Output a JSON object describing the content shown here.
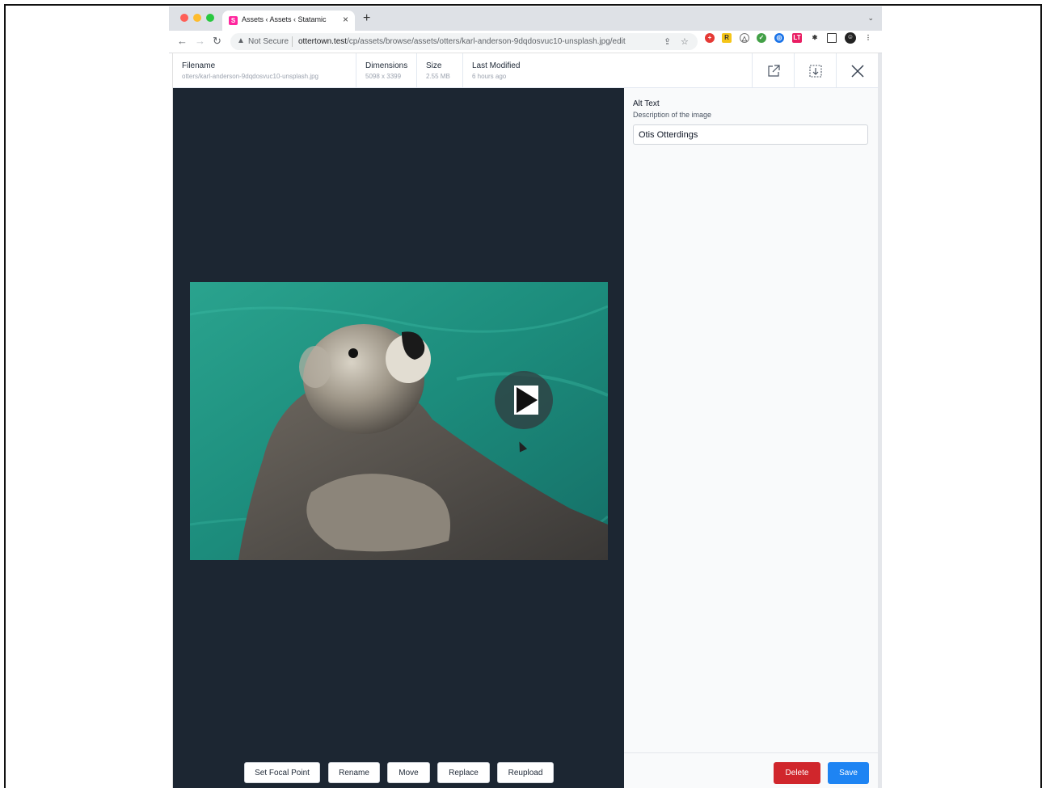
{
  "browser": {
    "tab_title": "Assets ‹ Assets ‹ Statamic",
    "tab_favicon": "S",
    "new_tab": "+",
    "tab_close": "×",
    "security_label": "Not Secure",
    "url_host": "ottertown.test",
    "url_path": "/cp/assets/browse/assets/otters/karl-anderson-9dqdosvuc10-unsplash.jpg/edit",
    "icons": [
      "back-arrow-icon",
      "forward-arrow-icon",
      "reload-icon",
      "warning-icon",
      "share-icon",
      "star-icon",
      "extension-icons",
      "puzzle-icon",
      "sidebar-icon",
      "profile-icon",
      "menu-icon"
    ]
  },
  "header": {
    "filename_label": "Filename",
    "filename_value": "otters/karl-anderson-9dqdosvuc10-unsplash.jpg",
    "dimensions_label": "Dimensions",
    "dimensions_value": "5098 x 3399",
    "size_label": "Size",
    "size_value": "2.55 MB",
    "modified_label": "Last Modified",
    "modified_value": "6 hours ago"
  },
  "actions": {
    "focal_point": "Set Focal Point",
    "rename": "Rename",
    "move": "Move",
    "replace": "Replace",
    "reupload": "Reupload"
  },
  "sidebar": {
    "alt_label": "Alt Text",
    "alt_help": "Description of the image",
    "alt_value": "Otis Otterdings"
  },
  "footer": {
    "delete": "Delete",
    "save": "Save"
  },
  "colors": {
    "preview_bg": "#1c2632",
    "delete": "#d0262c",
    "save": "#1e84f3",
    "water": "#1f8f7e"
  }
}
